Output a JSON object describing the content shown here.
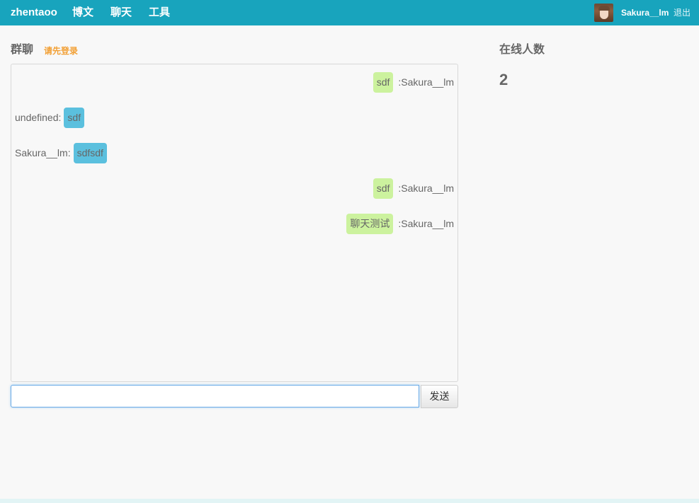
{
  "navbar": {
    "brand": "zhentaoo",
    "items": [
      {
        "label": "博文"
      },
      {
        "label": "聊天"
      },
      {
        "label": "工具"
      }
    ],
    "user": {
      "name": "Sakura__lm",
      "logout_label": "退出"
    }
  },
  "chat": {
    "title": "群聊",
    "login_hint": "请先登录",
    "messages": [
      {
        "align": "right",
        "sender": ":Sakura__lm",
        "text": "sdf",
        "bubble_color": "#ccf29e"
      },
      {
        "align": "left",
        "sender": "undefined:",
        "text": "sdf",
        "bubble_color": "#5bc0de"
      },
      {
        "align": "left",
        "sender": "Sakura__lm:",
        "text": "sdfsdf",
        "bubble_color": "#5bc0de"
      },
      {
        "align": "right",
        "sender": ":Sakura__lm",
        "text": "sdf",
        "bubble_color": "#ccf29e"
      },
      {
        "align": "right",
        "sender": ":Sakura__lm",
        "text": "聊天测试",
        "bubble_color": "#ccf29e"
      }
    ],
    "input": {
      "value": "",
      "placeholder": ""
    },
    "send_label": "发送"
  },
  "online": {
    "title": "在线人数",
    "count": "2"
  },
  "colors": {
    "navbar": "#18a4bd",
    "accent_orange": "#f2a035",
    "bubble_self": "#ccf29e",
    "bubble_other": "#5bc0de"
  }
}
